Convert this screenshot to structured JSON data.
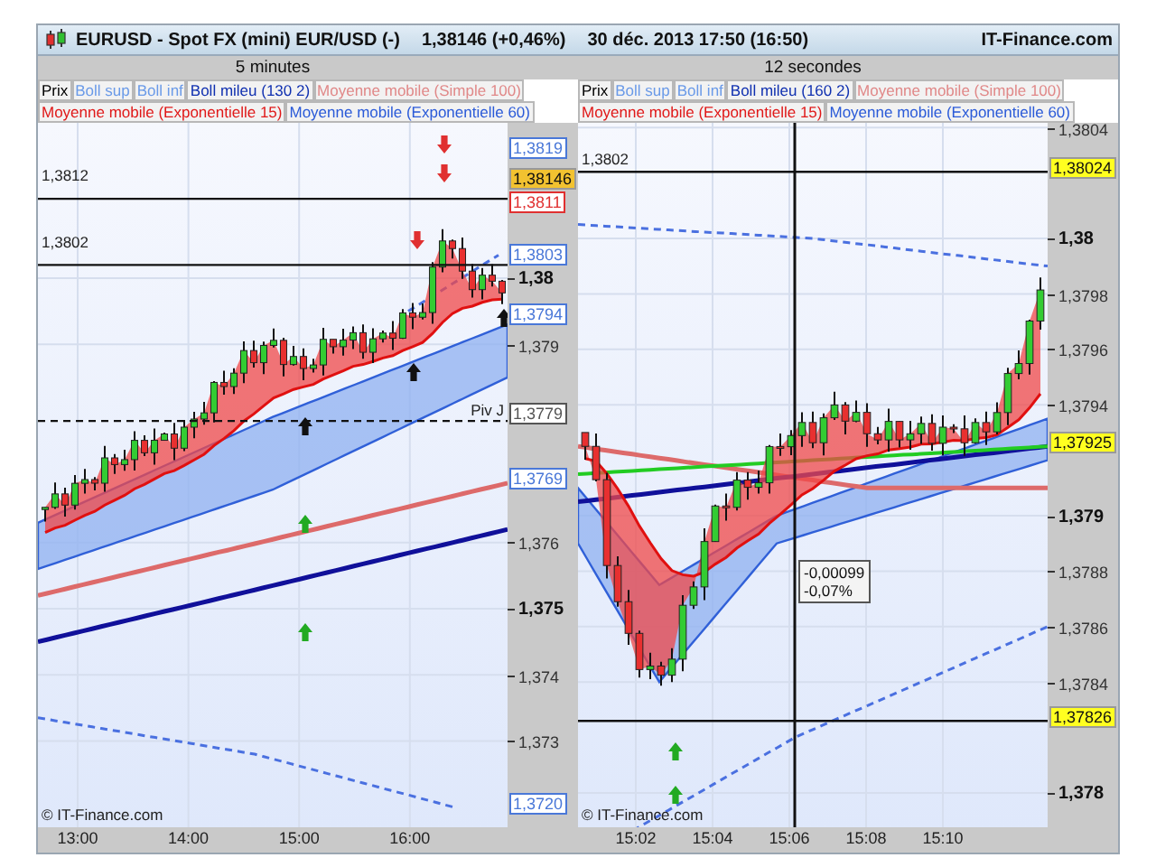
{
  "header": {
    "symbol": "EURUSD - Spot FX (mini) EUR/USD (-)",
    "quote": "1,38146 (+0,46%)",
    "datetime": "30 déc. 2013 17:50 (16:50)",
    "brand": "IT-Finance.com"
  },
  "panels": [
    {
      "period": "5 minutes",
      "legend": [
        [
          {
            "label": "Prix",
            "color": "#000000"
          },
          {
            "label": "Boll sup",
            "color": "#6a9ae8"
          },
          {
            "label": "Boll inf",
            "color": "#6a9ae8"
          },
          {
            "label": "Boll mileu (130 2)",
            "color": "#1030b0"
          },
          {
            "label": "Moyenne mobile (Simple 100)",
            "color": "#e08888"
          }
        ],
        [
          {
            "label": "Moyenne mobile (Exponentielle 15)",
            "color": "#e01818"
          },
          {
            "label": "Moyenne mobile (Exponentielle 60)",
            "color": "#2a5ad8"
          }
        ]
      ],
      "levels": [
        "1,3812",
        "1,3802"
      ],
      "pivot_label": "Piv J",
      "copyright": "© IT-Finance.com",
      "y_ticks": [
        {
          "label": "1,38",
          "major": true
        },
        {
          "label": "1,379",
          "major": false
        },
        {
          "label": "1,376",
          "major": false
        },
        {
          "label": "1,375",
          "major": true
        },
        {
          "label": "1,374",
          "major": false
        },
        {
          "label": "1,373",
          "major": false
        }
      ],
      "price_tags": [
        {
          "label": "1,3819",
          "kind": "outline",
          "color": "#4a78d8"
        },
        {
          "label": "1,38146",
          "kind": "highlight",
          "color": "#f2c230"
        },
        {
          "label": "1,3811",
          "kind": "outline",
          "color": "#e03030"
        },
        {
          "label": "1,3803",
          "kind": "outline",
          "color": "#4a78d8"
        },
        {
          "label": "1,3794",
          "kind": "outline",
          "color": "#4a78d8"
        },
        {
          "label": "1,3779",
          "kind": "outline",
          "color": "#555555"
        },
        {
          "label": "1,3769",
          "kind": "outline",
          "color": "#4a78d8"
        },
        {
          "label": "1,3720",
          "kind": "outline",
          "color": "#4a78d8"
        }
      ],
      "x_ticks": [
        "13:00",
        "14:00",
        "15:00",
        "16:00"
      ]
    },
    {
      "period": "12 secondes",
      "legend": [
        [
          {
            "label": "Prix",
            "color": "#000000"
          },
          {
            "label": "Boll sup",
            "color": "#6a9ae8"
          },
          {
            "label": "Boll inf",
            "color": "#6a9ae8"
          },
          {
            "label": "Boll mileu (160 2)",
            "color": "#1030b0"
          },
          {
            "label": "Moyenne mobile (Simple 100)",
            "color": "#e08888"
          }
        ],
        [
          {
            "label": "Moyenne mobile (Exponentielle 15)",
            "color": "#e01818"
          },
          {
            "label": "Moyenne mobile (Exponentielle 60)",
            "color": "#2a5ad8"
          }
        ]
      ],
      "levels": [
        "1,3802"
      ],
      "tooltip": [
        "-0,00099",
        "-0,07%"
      ],
      "copyright": "© IT-Finance.com",
      "y_ticks": [
        {
          "label": "1,3804",
          "major": false
        },
        {
          "label": "1,38",
          "major": true
        },
        {
          "label": "1,3798",
          "major": false
        },
        {
          "label": "1,3796",
          "major": false
        },
        {
          "label": "1,3794",
          "major": false
        },
        {
          "label": "1,379",
          "major": true
        },
        {
          "label": "1,3788",
          "major": false
        },
        {
          "label": "1,3786",
          "major": false
        },
        {
          "label": "1,3784",
          "major": false
        },
        {
          "label": "1,378",
          "major": true
        }
      ],
      "price_tags": [
        {
          "label": "1,38024",
          "kind": "highlight",
          "color": "#ffff20"
        },
        {
          "label": "1,37925",
          "kind": "highlight",
          "color": "#ffff20"
        },
        {
          "label": "1,37826",
          "kind": "highlight",
          "color": "#ffff20"
        }
      ],
      "x_ticks": [
        "15:02",
        "15:04",
        "15:06",
        "15:08",
        "15:10"
      ]
    }
  ]
}
